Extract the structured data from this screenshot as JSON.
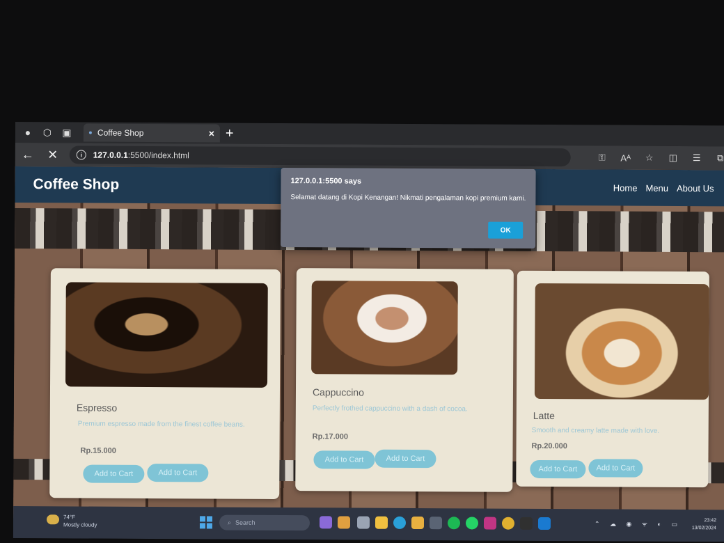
{
  "browser": {
    "tab_title": "Coffee Shop",
    "url_host": "127.0.0.1",
    "url_rest": ":5500/index.html"
  },
  "site": {
    "brand": "Coffee Shop",
    "nav": [
      "Home",
      "Menu",
      "About Us"
    ]
  },
  "dialog": {
    "title": "127.0.0.1:5500 says",
    "message": "Selamat datang di Kopi Kenangan! Nikmati pengalaman kopi premium kami.",
    "ok_label": "OK"
  },
  "products": [
    {
      "name": "Espresso",
      "description": "Premium espresso made from the finest coffee beans.",
      "price": "Rp.15.000",
      "buttons": [
        "Add to Cart",
        "Add to Cart"
      ]
    },
    {
      "name": "Cappuccino",
      "description": "Perfectly frothed cappuccino with a dash of cocoa.",
      "price": "Rp.17.000",
      "buttons": [
        "Add to Cart",
        "Add to Cart"
      ]
    },
    {
      "name": "Latte",
      "description": "Smooth and creamy latte made with love.",
      "price": "Rp.20.000",
      "buttons": [
        "Add to Cart",
        "Add to Cart"
      ]
    }
  ],
  "taskbar": {
    "weather_temp": "74°F",
    "weather_desc": "Mostly cloudy",
    "search_placeholder": "Search",
    "time": "23:42",
    "date": "13/02/2024"
  },
  "icons": {
    "profile": "profile-icon",
    "workspaces": "workspaces-icon",
    "tab_actions": "tab-actions-icon",
    "back": "back-arrow-icon",
    "stop": "stop-loading-icon",
    "info": "site-info-icon"
  },
  "colors": {
    "navbar": "#1f3a52",
    "card": "#ece6d6",
    "button": "#7fc4d6",
    "dialog": "#6e7280",
    "ok_button": "#1aa0d8"
  }
}
